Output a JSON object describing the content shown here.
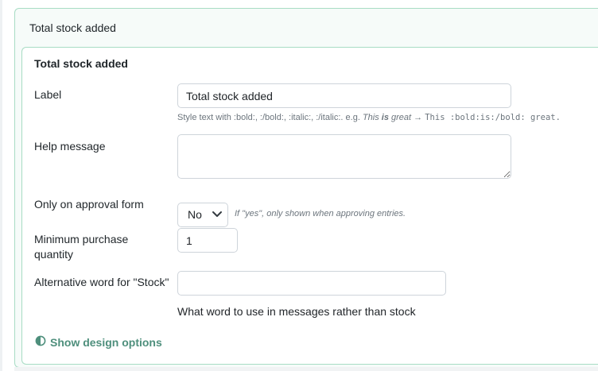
{
  "outer": {
    "header": "Total stock added"
  },
  "inner": {
    "title": "Total stock added"
  },
  "fields": {
    "label": {
      "label": "Label",
      "value": "Total stock added",
      "hint_prefix": "Style text with :bold:, :/bold:, :italic:, :/italic:. e.g. ",
      "hint_this": "This",
      "hint_is": "is",
      "hint_great": "great",
      "hint_arrow": " → ",
      "hint_code": "This :bold:is:/bold: great."
    },
    "help_message": {
      "label": "Help message",
      "value": ""
    },
    "approval": {
      "label": "Only on approval form",
      "selected": "No",
      "hint": "If \"yes\", only shown when approving entries."
    },
    "min_qty": {
      "label": "Minimum purchase quantity",
      "value": "1"
    },
    "alt_word": {
      "label": "Alternative word for \"Stock\"",
      "value": "",
      "hint": "What word to use in messages rather than stock"
    }
  },
  "design_options": {
    "label": "Show design options",
    "icon": "half-circle-icon"
  },
  "colors": {
    "accent": "#4e8f7c",
    "border": "#a8dcc4"
  }
}
